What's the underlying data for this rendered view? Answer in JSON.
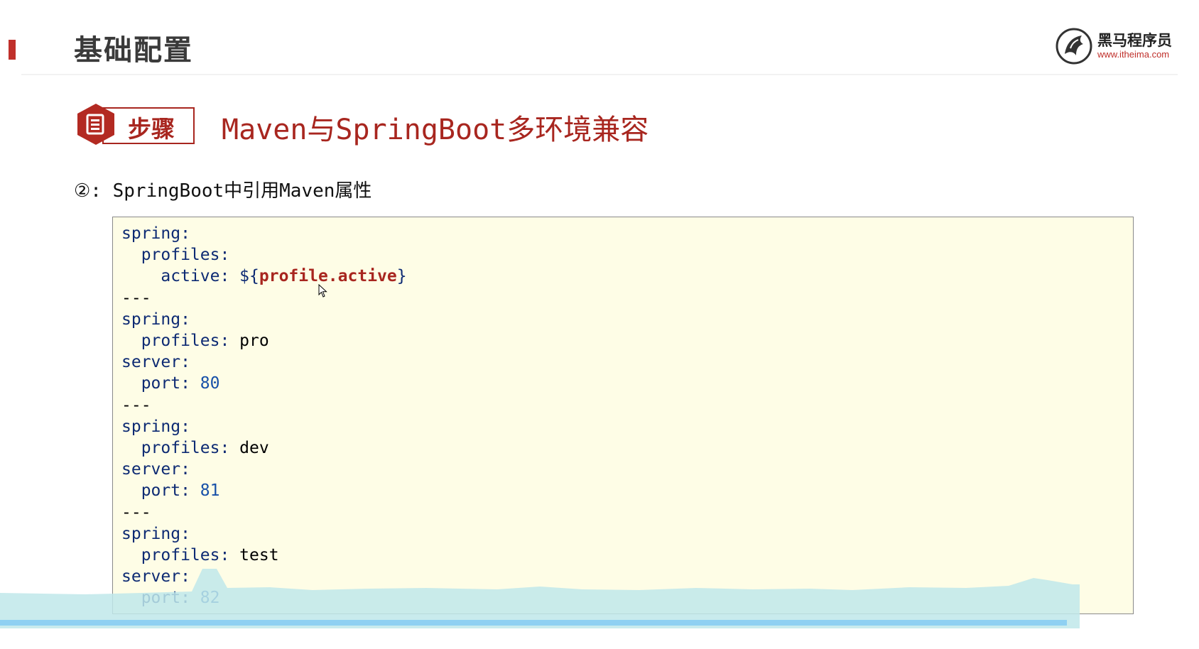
{
  "slide": {
    "title": "基础配置"
  },
  "logo": {
    "name": "黑马程序员",
    "url": "www.itheima.com"
  },
  "step": {
    "label": "步骤",
    "title": "Maven与SpringBoot多环境兼容"
  },
  "subtitle": "②: SpringBoot中引用Maven属性",
  "code": {
    "lines": [
      "spring:",
      "  profiles:",
      "    active: ${profile.active}",
      "---",
      "spring:",
      "  profiles: pro",
      "server:",
      "  port: 80",
      "---",
      "spring:",
      "  profiles: dev",
      "server:",
      "  port: 81",
      "---",
      "spring:",
      "  profiles: test",
      "server:",
      "  port: 82"
    ]
  },
  "colors": {
    "accent": "#a8261f",
    "code_background": "#fefde6",
    "progress": "#8fd0f2"
  },
  "icons": [
    "document-icon",
    "logo-horse-icon",
    "mouse-cursor-icon"
  ]
}
